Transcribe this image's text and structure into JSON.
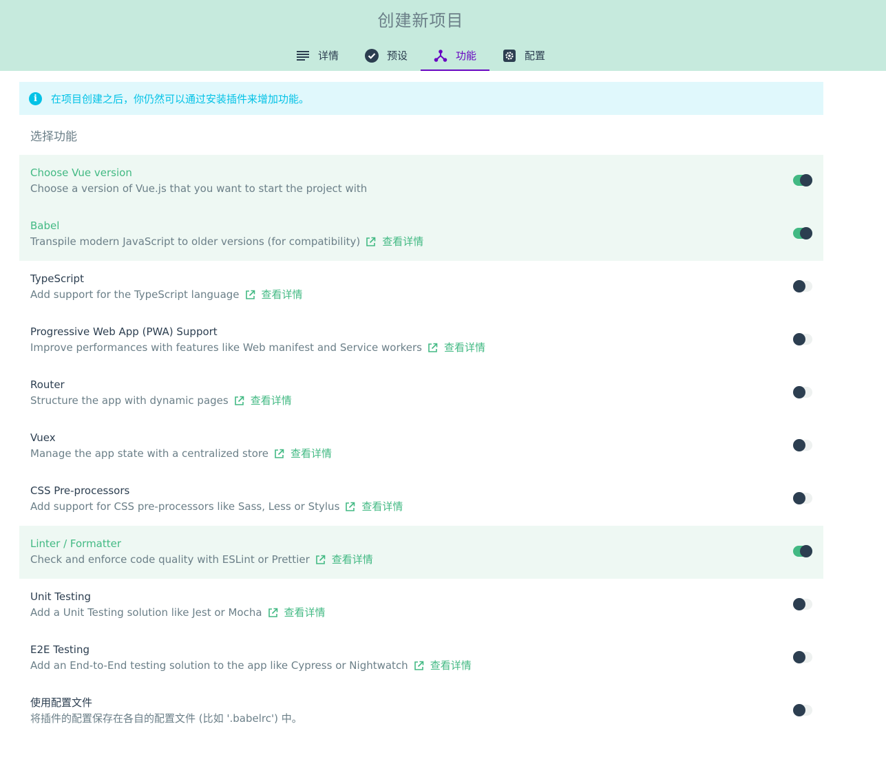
{
  "header": {
    "title": "创建新项目",
    "tabs": [
      {
        "label": "详情",
        "icon": "list-icon",
        "active": false
      },
      {
        "label": "预设",
        "icon": "check-circle-icon",
        "active": false
      },
      {
        "label": "功能",
        "icon": "features-icon",
        "active": true
      },
      {
        "label": "配置",
        "icon": "settings-icon",
        "active": false
      }
    ]
  },
  "info_banner": {
    "text": "在项目创建之后，你仍然可以通过安装插件来增加功能。"
  },
  "section_title": "选择功能",
  "more_info_label": "查看详情",
  "features": [
    {
      "name": "Choose Vue version",
      "description": "Choose a version of Vue.js that you want to start the project with",
      "enabled": true,
      "has_link": false
    },
    {
      "name": "Babel",
      "description": "Transpile modern JavaScript to older versions (for compatibility)",
      "enabled": true,
      "has_link": true
    },
    {
      "name": "TypeScript",
      "description": "Add support for the TypeScript language",
      "enabled": false,
      "has_link": true
    },
    {
      "name": "Progressive Web App (PWA) Support",
      "description": "Improve performances with features like Web manifest and Service workers",
      "enabled": false,
      "has_link": true
    },
    {
      "name": "Router",
      "description": "Structure the app with dynamic pages",
      "enabled": false,
      "has_link": true
    },
    {
      "name": "Vuex",
      "description": "Manage the app state with a centralized store",
      "enabled": false,
      "has_link": true
    },
    {
      "name": "CSS Pre-processors",
      "description": "Add support for CSS pre-processors like Sass, Less or Stylus",
      "enabled": false,
      "has_link": true
    },
    {
      "name": "Linter / Formatter",
      "description": "Check and enforce code quality with ESLint or Prettier",
      "enabled": true,
      "has_link": true
    },
    {
      "name": "Unit Testing",
      "description": "Add a Unit Testing solution like Jest or Mocha",
      "enabled": false,
      "has_link": true
    },
    {
      "name": "E2E Testing",
      "description": "Add an End-to-End testing solution to the app like Cypress or Nightwatch",
      "enabled": false,
      "has_link": true
    },
    {
      "name": "使用配置文件",
      "description": "将插件的配置保存在各自的配置文件 (比如 '.babelrc') 中。",
      "enabled": false,
      "has_link": false
    }
  ],
  "colors": {
    "header_bg": "#c6eadd",
    "accent": "#42b983",
    "active_tab": "#6806c1",
    "info": "#03c2e6",
    "text": "#2c3e50",
    "muted": "#6b7f88"
  }
}
